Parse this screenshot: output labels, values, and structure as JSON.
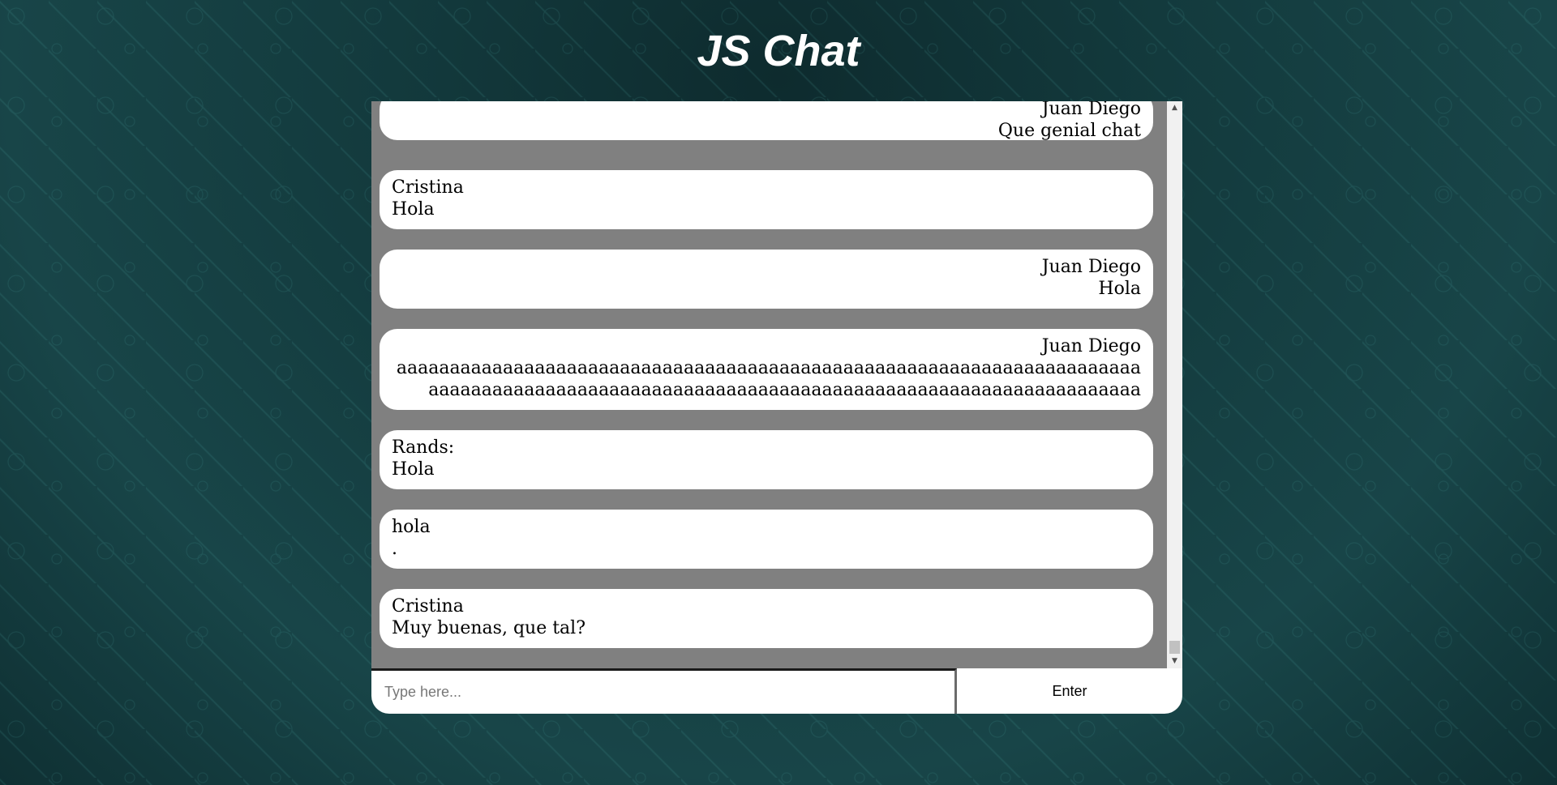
{
  "app": {
    "title": "JS Chat"
  },
  "messages": [
    {
      "author": "Juan Diego",
      "text": "Que genial chat",
      "align": "right"
    },
    {
      "author": "Cristina",
      "text": "Hola",
      "align": "left"
    },
    {
      "author": "Juan Diego",
      "text": "Hola",
      "align": "right"
    },
    {
      "author": "Juan Diego",
      "text": "aaaaaaaaaaaaaaaaaaaaaaaaaaaaaaaaaaaaaaaaaaaaaaaaaaaaaaaaaaaaaaaaaaaaaaaaaaaaaaaaaaaaaaaaaaaaaaaaaaaaaaaaaaaaaaaaaaaaaaaaaaaaaaaaaaaaaaaaa",
      "align": "right"
    },
    {
      "author": "Rands:",
      "text": "Hola",
      "align": "left"
    },
    {
      "author": "hola",
      "text": ".",
      "align": "left"
    },
    {
      "author": "Cristina",
      "text": "Muy buenas, que tal?",
      "align": "left"
    }
  ],
  "composer": {
    "placeholder": "Type here...",
    "value": "",
    "send_label": "Enter"
  },
  "colors": {
    "chat_bg": "#808080",
    "bubble_bg": "#ffffff",
    "title": "#ffffff"
  }
}
